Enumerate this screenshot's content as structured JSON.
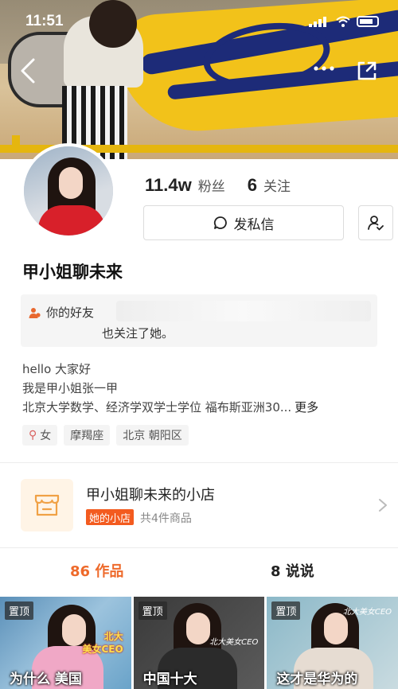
{
  "status_bar": {
    "time": "11:51"
  },
  "profile": {
    "name": "甲小姐聊未来",
    "followers_count": "11.4w",
    "followers_label": "粉丝",
    "following_count": "6",
    "following_label": "关注",
    "dm_button_label": "发私信"
  },
  "friend_notice": {
    "line1": "你的好友",
    "line2": "也关注了她。"
  },
  "bio": {
    "line1": "hello 大家好",
    "line2": "我是甲小姐张一甲",
    "line3": "北京大学数学、经济学双学士学位 福布斯亚洲30...",
    "more_label": "更多"
  },
  "tags": [
    {
      "label": "女",
      "icon": "female-icon"
    },
    {
      "label": "摩羯座"
    },
    {
      "label": "北京 朝阳区"
    }
  ],
  "shop": {
    "title": "甲小姐聊未来的小店",
    "badge": "她的小店",
    "count_text": "共4件商品"
  },
  "tabs": [
    {
      "label": "86 作品",
      "active": true
    },
    {
      "label": "8 说说",
      "active": false
    }
  ],
  "videos": [
    {
      "pin": "置顶",
      "caption": "为什么 美国",
      "tag_line1": "北大",
      "tag_line2": "美女CEO"
    },
    {
      "pin": "置顶",
      "caption": "中国十大",
      "tag_small": "北大美女CEO"
    },
    {
      "pin": "置顶",
      "caption": "这才是华为的",
      "tag_small": "北大美女CEO"
    }
  ],
  "colors": {
    "accent": "#ee6a2b",
    "shop_badge": "#f35b1f",
    "banner_yellow": "#f2c21a",
    "banner_blue": "#1d2b78"
  }
}
